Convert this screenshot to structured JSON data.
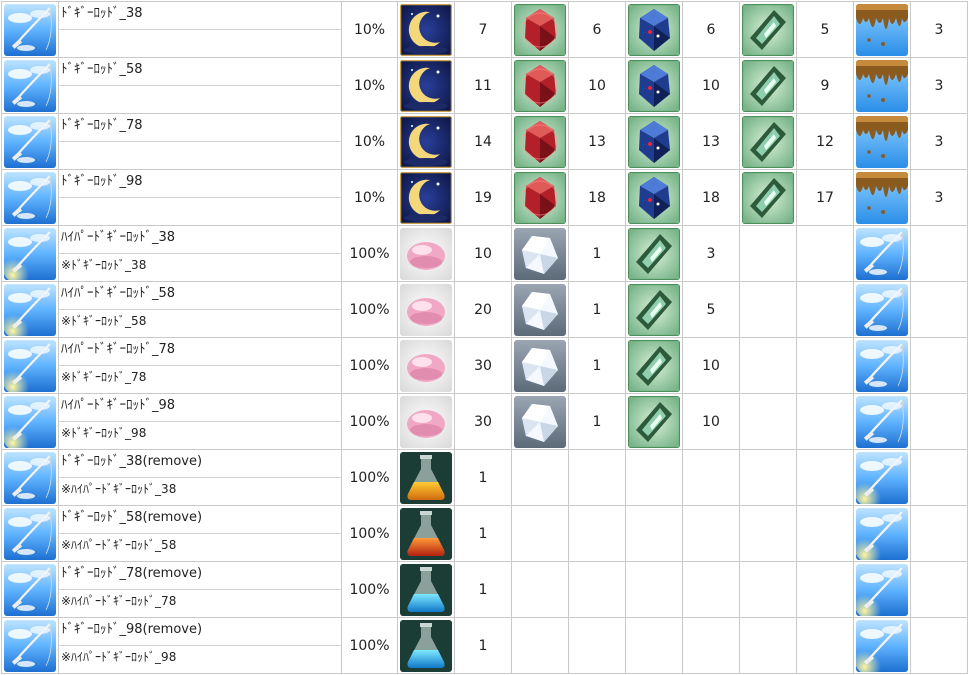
{
  "rows": [
    {
      "name": "ﾄﾞｷﾞｰﾛｯﾄﾞ_38",
      "sub": "",
      "rate": "10%",
      "items": [
        {
          "icon": "moon-icon",
          "qty": "7"
        },
        {
          "icon": "red-gem-icon",
          "qty": "6"
        },
        {
          "icon": "blue-gem-icon",
          "qty": "6"
        },
        {
          "icon": "green-crystal-icon",
          "qty": "5"
        },
        {
          "icon": "melting-dripping-icon",
          "qty": "3"
        }
      ]
    },
    {
      "name": "ﾄﾞｷﾞｰﾛｯﾄﾞ_58",
      "sub": "",
      "rate": "10%",
      "items": [
        {
          "icon": "moon-icon",
          "qty": "11"
        },
        {
          "icon": "red-gem-icon",
          "qty": "10"
        },
        {
          "icon": "blue-gem-icon",
          "qty": "10"
        },
        {
          "icon": "green-crystal-icon",
          "qty": "9"
        },
        {
          "icon": "melting-dripping-icon",
          "qty": "3"
        }
      ]
    },
    {
      "name": "ﾄﾞｷﾞｰﾛｯﾄﾞ_78",
      "sub": "",
      "rate": "10%",
      "items": [
        {
          "icon": "moon-icon",
          "qty": "14"
        },
        {
          "icon": "red-gem-icon",
          "qty": "13"
        },
        {
          "icon": "blue-gem-icon",
          "qty": "13"
        },
        {
          "icon": "green-crystal-icon",
          "qty": "12"
        },
        {
          "icon": "melting-dripping-icon",
          "qty": "3"
        }
      ]
    },
    {
      "name": "ﾄﾞｷﾞｰﾛｯﾄﾞ_98",
      "sub": "",
      "rate": "10%",
      "items": [
        {
          "icon": "moon-icon",
          "qty": "19"
        },
        {
          "icon": "red-gem-icon",
          "qty": "18"
        },
        {
          "icon": "blue-gem-icon",
          "qty": "18"
        },
        {
          "icon": "green-crystal-icon",
          "qty": "17"
        },
        {
          "icon": "melting-dripping-icon",
          "qty": "3"
        }
      ]
    },
    {
      "name": "ﾊｲﾊﾟｰﾄﾞｷﾞｰﾛｯﾄﾞ_38",
      "sub": "※ﾄﾞｷﾞｰﾛｯﾄﾞ_38",
      "rate": "100%",
      "items": [
        {
          "icon": "pink-stone-icon",
          "qty": "10"
        },
        {
          "icon": "white-crystal-icon",
          "qty": "1"
        },
        {
          "icon": "green-crystal-icon",
          "qty": "3"
        },
        {
          "icon": "",
          "qty": ""
        },
        {
          "icon": "fishing-rod-icon",
          "qty": ""
        }
      ]
    },
    {
      "name": "ﾊｲﾊﾟｰﾄﾞｷﾞｰﾛｯﾄﾞ_58",
      "sub": "※ﾄﾞｷﾞｰﾛｯﾄﾞ_58",
      "rate": "100%",
      "items": [
        {
          "icon": "pink-stone-icon",
          "qty": "20"
        },
        {
          "icon": "white-crystal-icon",
          "qty": "1"
        },
        {
          "icon": "green-crystal-icon",
          "qty": "5"
        },
        {
          "icon": "",
          "qty": ""
        },
        {
          "icon": "fishing-rod-icon",
          "qty": ""
        }
      ]
    },
    {
      "name": "ﾊｲﾊﾟｰﾄﾞｷﾞｰﾛｯﾄﾞ_78",
      "sub": "※ﾄﾞｷﾞｰﾛｯﾄﾞ_78",
      "rate": "100%",
      "items": [
        {
          "icon": "pink-stone-icon",
          "qty": "30"
        },
        {
          "icon": "white-crystal-icon",
          "qty": "1"
        },
        {
          "icon": "green-crystal-icon",
          "qty": "10"
        },
        {
          "icon": "",
          "qty": ""
        },
        {
          "icon": "fishing-rod-icon",
          "qty": ""
        }
      ]
    },
    {
      "name": "ﾊｲﾊﾟｰﾄﾞｷﾞｰﾛｯﾄﾞ_98",
      "sub": "※ﾄﾞｷﾞｰﾛｯﾄﾞ_98",
      "rate": "100%",
      "items": [
        {
          "icon": "pink-stone-icon",
          "qty": "30"
        },
        {
          "icon": "white-crystal-icon",
          "qty": "1"
        },
        {
          "icon": "green-crystal-icon",
          "qty": "10"
        },
        {
          "icon": "",
          "qty": ""
        },
        {
          "icon": "fishing-rod-icon",
          "qty": ""
        }
      ]
    },
    {
      "name": "ﾄﾞｷﾞｰﾛｯﾄﾞ_38(remove)",
      "sub": "※ﾊｲﾊﾟｰﾄﾞｷﾞｰﾛｯﾄﾞ_38",
      "rate": "100%",
      "items": [
        {
          "icon": "orange-flask-icon",
          "qty": "1"
        },
        {
          "icon": "",
          "qty": ""
        },
        {
          "icon": "",
          "qty": ""
        },
        {
          "icon": "",
          "qty": ""
        },
        {
          "icon": "fishing-rod-glow-icon",
          "qty": ""
        }
      ]
    },
    {
      "name": "ﾄﾞｷﾞｰﾛｯﾄﾞ_58(remove)",
      "sub": "※ﾊｲﾊﾟｰﾄﾞｷﾞｰﾛｯﾄﾞ_58",
      "rate": "100%",
      "items": [
        {
          "icon": "red-flask-icon",
          "qty": "1"
        },
        {
          "icon": "",
          "qty": ""
        },
        {
          "icon": "",
          "qty": ""
        },
        {
          "icon": "",
          "qty": ""
        },
        {
          "icon": "fishing-rod-glow-icon",
          "qty": ""
        }
      ]
    },
    {
      "name": "ﾄﾞｷﾞｰﾛｯﾄﾞ_78(remove)",
      "sub": "※ﾊｲﾊﾟｰﾄﾞｷﾞｰﾛｯﾄﾞ_78",
      "rate": "100%",
      "items": [
        {
          "icon": "blue-flask-icon",
          "qty": "1"
        },
        {
          "icon": "",
          "qty": ""
        },
        {
          "icon": "",
          "qty": ""
        },
        {
          "icon": "",
          "qty": ""
        },
        {
          "icon": "fishing-rod-glow-icon",
          "qty": ""
        }
      ]
    },
    {
      "name": "ﾄﾞｷﾞｰﾛｯﾄﾞ_98(remove)",
      "sub": "※ﾊｲﾊﾟｰﾄﾞｷﾞｰﾛｯﾄﾞ_98",
      "rate": "100%",
      "items": [
        {
          "icon": "blue-flask-icon",
          "qty": "1"
        },
        {
          "icon": "",
          "qty": ""
        },
        {
          "icon": "",
          "qty": ""
        },
        {
          "icon": "",
          "qty": ""
        },
        {
          "icon": "fishing-rod-glow-icon",
          "qty": ""
        }
      ]
    }
  ],
  "row_icons": [
    "fishing-rod-icon",
    "fishing-rod-icon",
    "fishing-rod-icon",
    "fishing-rod-icon",
    "fishing-rod-glow-icon",
    "fishing-rod-glow-icon",
    "fishing-rod-glow-icon",
    "fishing-rod-glow-icon",
    "fishing-rod-icon",
    "fishing-rod-icon",
    "fishing-rod-icon",
    "fishing-rod-icon"
  ]
}
